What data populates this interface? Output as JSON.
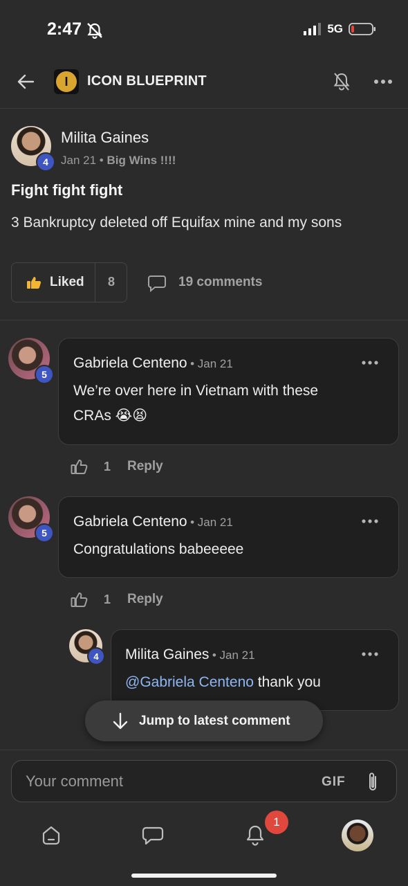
{
  "status_bar": {
    "time": "2:47",
    "network": "5G"
  },
  "header": {
    "title": "ICON BLUEPRINT",
    "logo_letter": "I"
  },
  "post": {
    "author": "Milita Gaines",
    "level": "4",
    "date": "Jan 21",
    "separator": "•",
    "category": "Big Wins !!!!",
    "title": "Fight fight fight",
    "body": "3 Bankruptcy deleted off Equifax mine and my sons",
    "liked_label": "Liked",
    "like_count": "8",
    "comments_label": "19 comments"
  },
  "comments": [
    {
      "author": "Gabriela Centeno",
      "level": "5",
      "date": "• Jan 21",
      "text_line1": "We’re over here in Vietnam with these",
      "text_line2": "CRAs 😭😫",
      "likes": "1",
      "reply_label": "Reply"
    },
    {
      "author": "Gabriela Centeno",
      "level": "5",
      "date": "• Jan 21",
      "text": "Congratulations babeeeee",
      "likes": "1",
      "reply_label": "Reply"
    },
    {
      "author": "Milita Gaines",
      "level": "4",
      "date": "• Jan 21",
      "mention": "@Gabriela Centeno",
      "text": " thank you"
    }
  ],
  "jump_button": {
    "label": "Jump to latest comment"
  },
  "composer": {
    "placeholder": "Your comment",
    "gif_label": "GIF"
  },
  "bottom_nav": {
    "notification_count": "1"
  },
  "colors": {
    "badge": "#3f55c2",
    "mention": "#8fb6f2",
    "notification": "#e0483e",
    "background": "#2b2b2b"
  }
}
